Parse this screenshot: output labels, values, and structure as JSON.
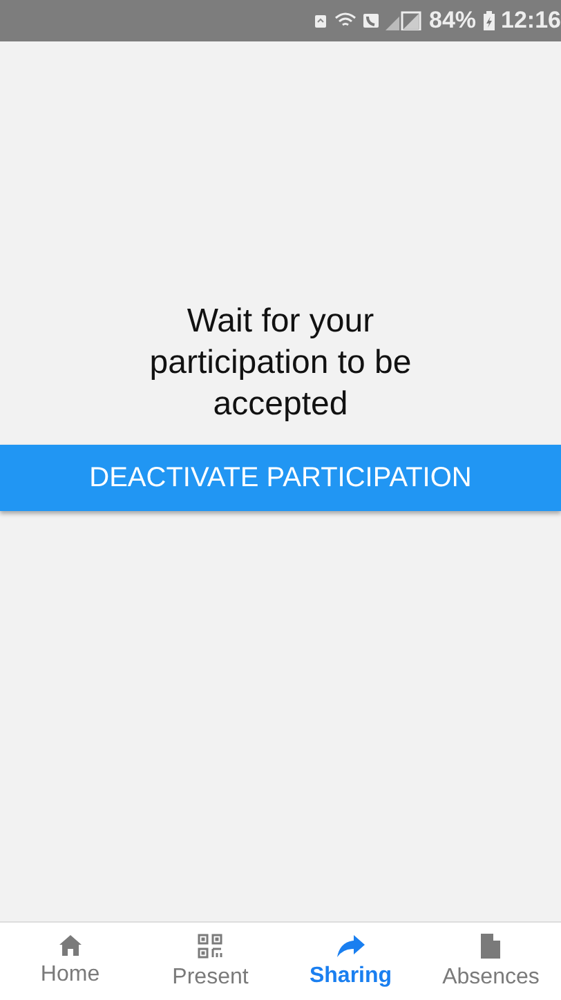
{
  "status_bar": {
    "battery": "84%",
    "time": "12:16"
  },
  "message": "Wait for your participation to be accepted",
  "action_button": "DEACTIVATE PARTICIPATION",
  "bottom_nav": [
    {
      "label": "Home",
      "kind": "home",
      "selected": false
    },
    {
      "label": "Present",
      "kind": "qr",
      "selected": false
    },
    {
      "label": "Sharing",
      "kind": "share",
      "selected": true
    },
    {
      "label": "Absences",
      "kind": "file",
      "selected": false
    }
  ]
}
